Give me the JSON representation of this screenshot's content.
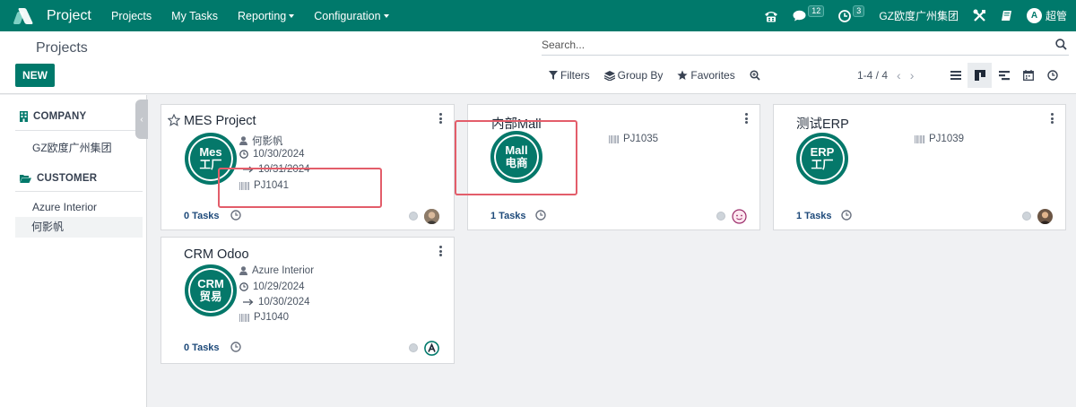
{
  "navbar": {
    "app_name": "Project",
    "menu": [
      {
        "label": "Projects",
        "dropdown": false
      },
      {
        "label": "My Tasks",
        "dropdown": false
      },
      {
        "label": "Reporting",
        "dropdown": true
      },
      {
        "label": "Configuration",
        "dropdown": true
      }
    ],
    "messages_count": "12",
    "activities_count": "3",
    "company": "GZ欧度广州集团",
    "user": "超管",
    "user_initial": "A",
    "accent": "#00796b"
  },
  "control": {
    "breadcrumb": "Projects",
    "new_label": "NEW",
    "search_placeholder": "Search...",
    "filters_label": "Filters",
    "groupby_label": "Group By",
    "favorites_label": "Favorites",
    "pager": "1-4 / 4"
  },
  "sidepanel": {
    "company_header": "COMPANY",
    "company_items": [
      "GZ欧度广州集团"
    ],
    "customer_header": "CUSTOMER",
    "customer_items": [
      "Azure Interior",
      "何影帆"
    ]
  },
  "cards": [
    {
      "title": "MES Project",
      "logo_l1": "Mes",
      "logo_l2": "工厂",
      "customer": "何影帆",
      "date_start": "10/30/2024",
      "date_end": "10/31/2024",
      "code": "PJ1041",
      "tasks": "0 Tasks",
      "favorite": false
    },
    {
      "title": "内部Mall",
      "logo_l1": "Mall",
      "logo_l2": "电商",
      "code": "PJ1035",
      "tasks": "1 Tasks"
    },
    {
      "title": "测试ERP",
      "logo_l1": "ERP",
      "logo_l2": "工厂",
      "code": "PJ1039",
      "tasks": "1 Tasks"
    },
    {
      "title": "CRM Odoo",
      "logo_l1": "CRM",
      "logo_l2": "贸易",
      "customer": "Azure Interior",
      "date_start": "10/29/2024",
      "date_end": "10/30/2024",
      "code": "PJ1040",
      "tasks": "0 Tasks"
    }
  ],
  "colors": {
    "highlight_box": "#e35d6a",
    "logo": "#05786a",
    "tasks_text": "#1e4a7a"
  }
}
